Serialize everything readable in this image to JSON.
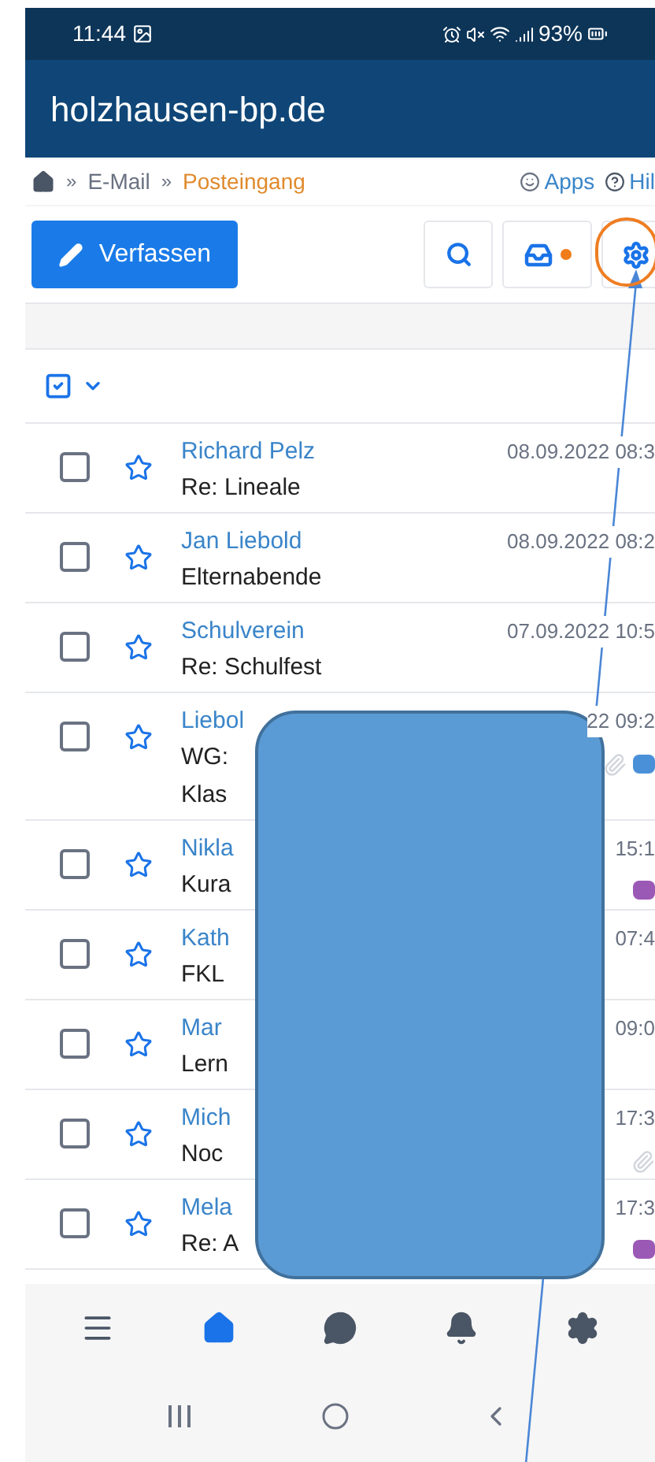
{
  "status_bar": {
    "time": "11:44",
    "battery": "93%"
  },
  "header": {
    "title": "holzhausen-bp.de"
  },
  "breadcrumb": {
    "items": [
      {
        "label": "E-Mail",
        "current": false
      },
      {
        "label": "Posteingang",
        "current": true
      }
    ],
    "separator": "»",
    "links": [
      "Apps",
      "Hil"
    ]
  },
  "toolbar": {
    "compose": "Verfassen",
    "inbox_unread": true
  },
  "messages": [
    {
      "sender": "Richard Pelz",
      "date": "08.09.2022 08:3",
      "subject": [
        "Re: Lineale"
      ],
      "checked": false,
      "starred": false,
      "attachment": false
    },
    {
      "sender": "Jan Liebold",
      "date": "08.09.2022 08:2",
      "subject": [
        "Elternabende"
      ],
      "checked": false,
      "starred": false,
      "attachment": false
    },
    {
      "sender": "Schulverein",
      "date": "07.09.2022 10:5",
      "subject": [
        "Re: Schulfest"
      ],
      "checked": false,
      "starred": false,
      "attachment": false
    },
    {
      "sender": "Liebol",
      "date": "22 09:2",
      "subject": [
        "WG:",
        "Klas"
      ],
      "checked": false,
      "starred": false,
      "attachment": true,
      "color": "#4a90d9"
    },
    {
      "sender": "Nikla",
      "date": "15:1",
      "subject": [
        "Kura"
      ],
      "checked": false,
      "starred": false,
      "attachment": false,
      "color": "#9b59b6"
    },
    {
      "sender": "Kath",
      "date": "07:4",
      "subject": [
        "FKL"
      ],
      "checked": false,
      "starred": false,
      "attachment": false
    },
    {
      "sender": "Mar",
      "date": "09:0",
      "subject": [
        "Lern"
      ],
      "checked": false,
      "starred": false,
      "attachment": false
    },
    {
      "sender": "Mich",
      "date": "17:3",
      "subject": [
        "Noc"
      ],
      "checked": false,
      "starred": false,
      "attachment": true
    },
    {
      "sender": "Mela",
      "date": "17:3",
      "subject": [
        "Re: A"
      ],
      "checked": false,
      "starred": false,
      "attachment": false,
      "color": "#9b59b6"
    }
  ],
  "bottom_nav": [
    {
      "kind": "menu",
      "selected": false
    },
    {
      "kind": "home",
      "selected": true
    },
    {
      "kind": "chat",
      "selected": false
    },
    {
      "kind": "bell",
      "selected": false
    },
    {
      "kind": "settings",
      "selected": false
    }
  ]
}
